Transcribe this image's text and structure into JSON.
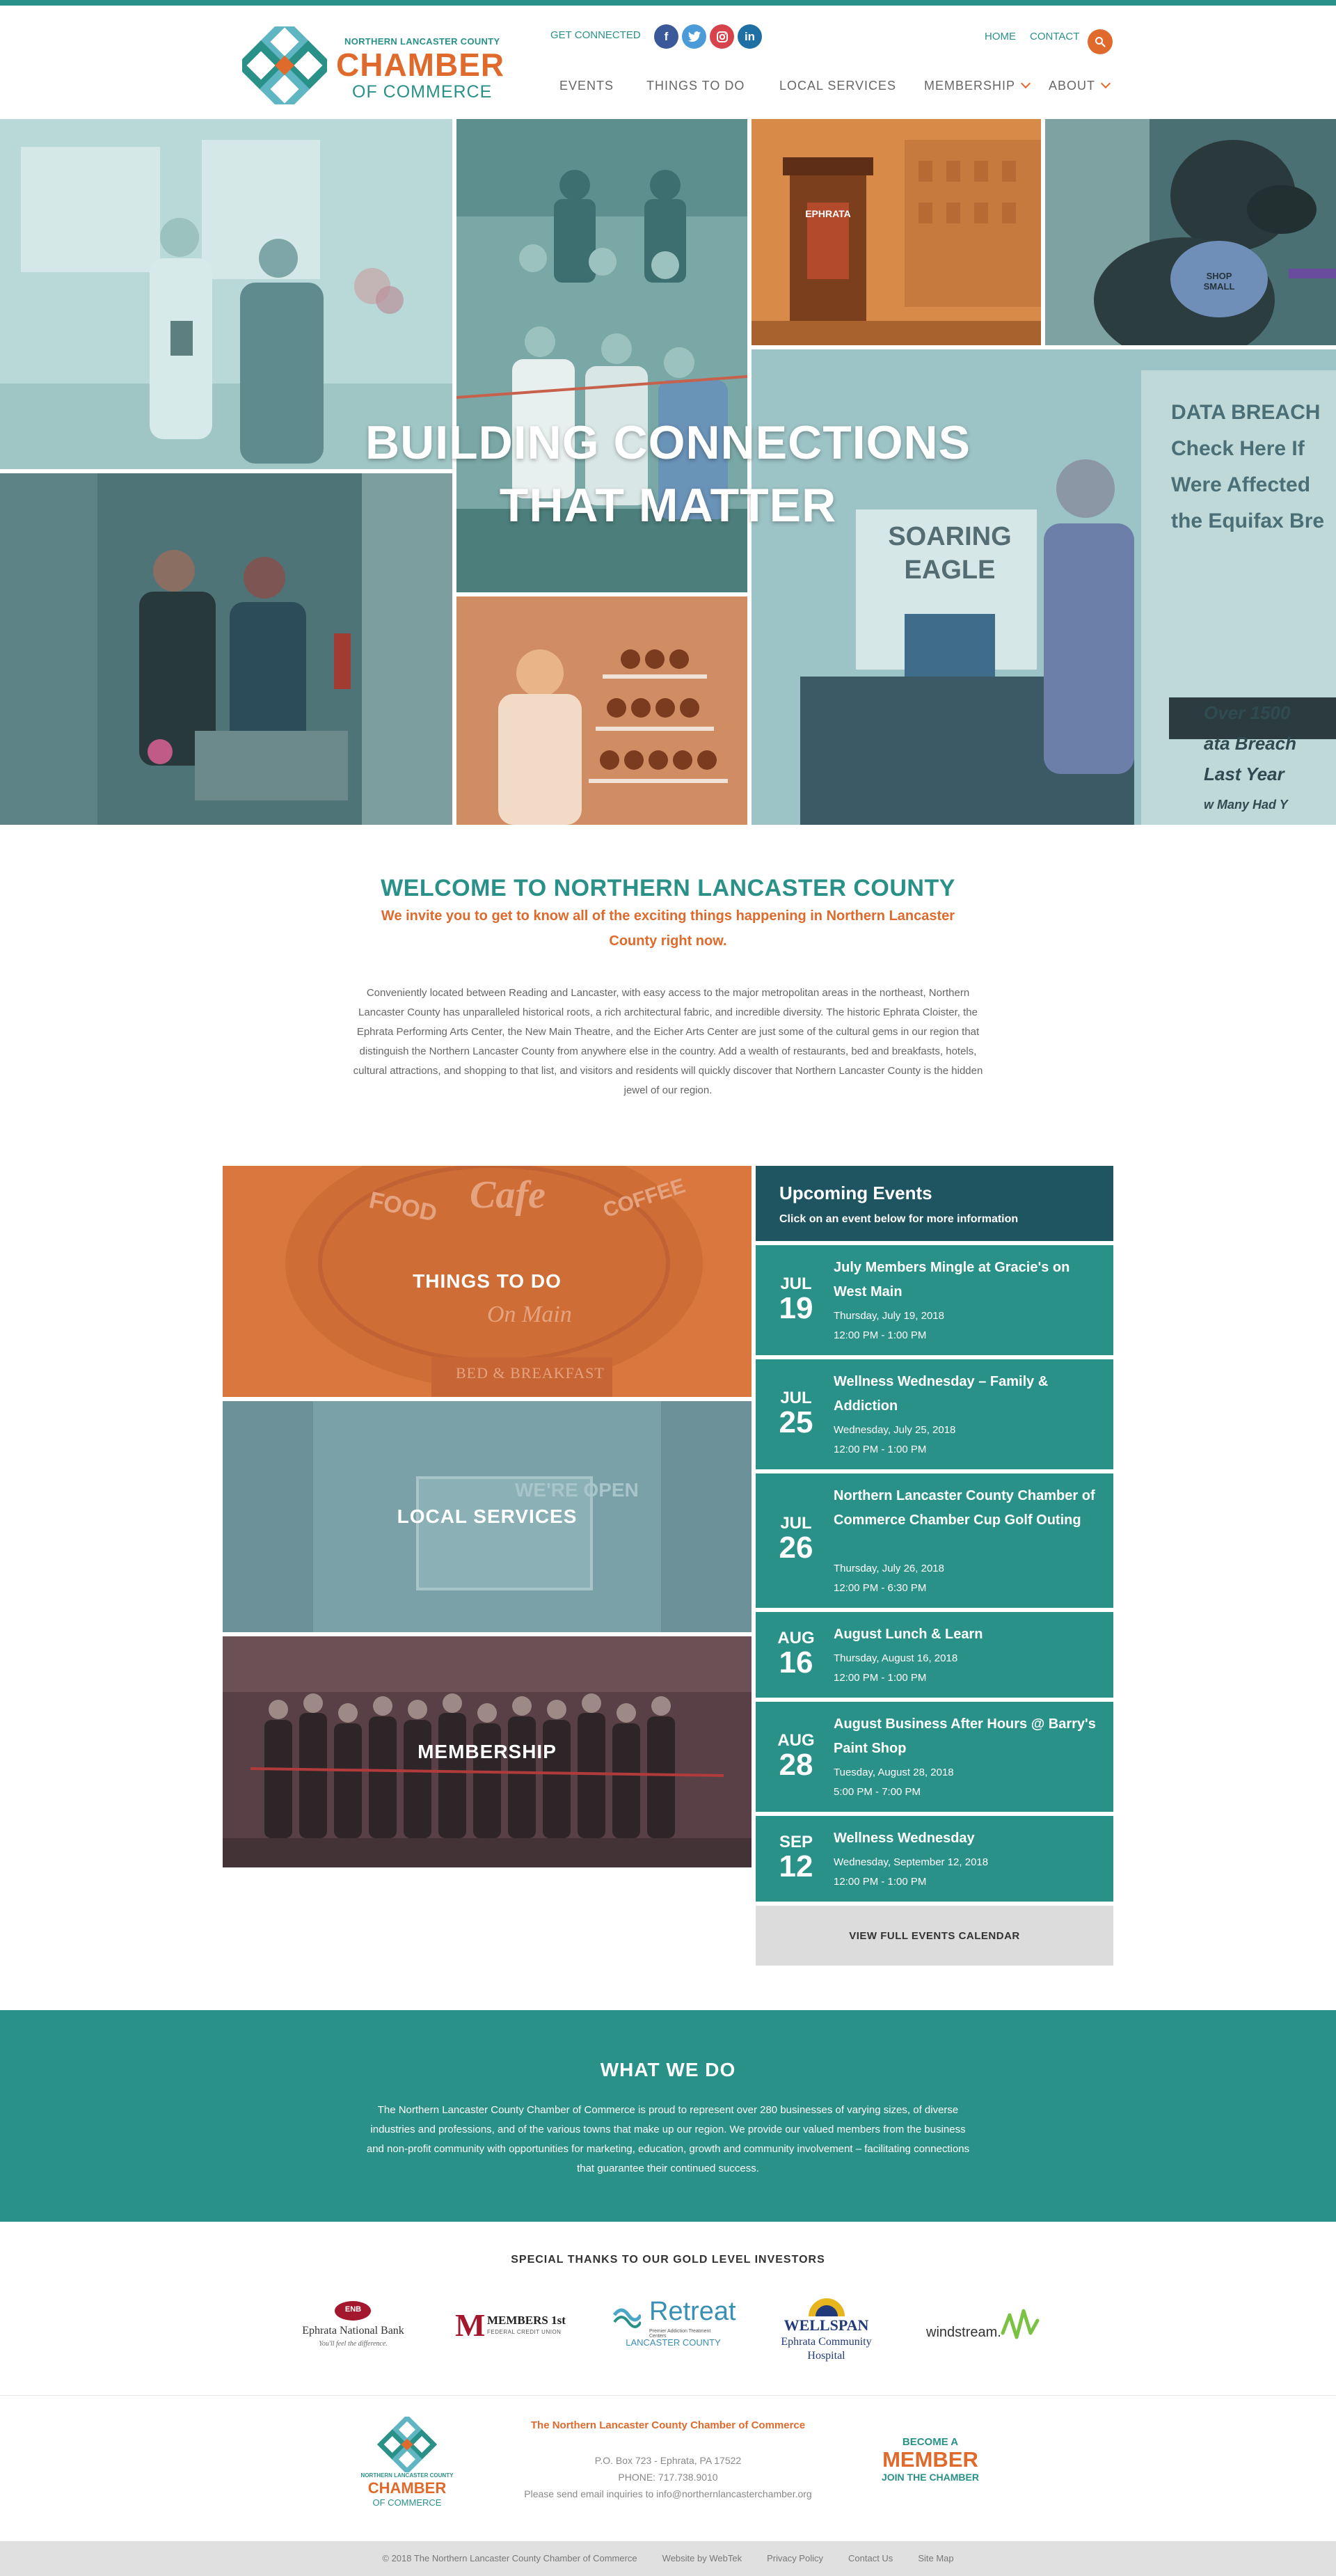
{
  "brand": {
    "logo_small": "NORTHERN LANCASTER COUNTY",
    "logo_big": "CHAMBER",
    "logo_sub": "OF COMMERCE",
    "teal": "#2a9189",
    "orange": "#e06a2c",
    "dark_teal": "#1f5560"
  },
  "header": {
    "get_connected": "GET CONNECTED",
    "socials": [
      {
        "name": "facebook-icon",
        "glyph": "f"
      },
      {
        "name": "twitter-icon",
        "glyph": "t"
      },
      {
        "name": "instagram-icon",
        "glyph": "◎"
      },
      {
        "name": "linkedin-icon",
        "glyph": "in"
      }
    ],
    "util_nav": [
      "HOME",
      "CONTACT"
    ],
    "nav": {
      "events": "EVENTS",
      "things": "THINGS TO DO",
      "local": "LOCAL SERVICES",
      "membership": "MEMBERSHIP",
      "about": "ABOUT"
    }
  },
  "hero": {
    "line1": "BUILDING CONNECTIONS",
    "line2": "THAT MATTER",
    "sign_title": "EPHRATA",
    "poster_text": "DATA BREACH",
    "poster_lines": [
      "Check Here If",
      "Were Affected",
      "the Equifax Bre"
    ],
    "poster_bottom": [
      "Over 1500",
      "ata Breach",
      "Last Year",
      "w Many Had Y"
    ],
    "board_text": [
      "SOARING",
      "EAGLE"
    ],
    "dog_bandana": "SHOP SMALL"
  },
  "welcome": {
    "title": "WELCOME TO NORTHERN LANCASTER COUNTY",
    "subtitle": "We invite you to get to know all of the exciting things happening in Northern Lancaster County right now.",
    "body": "Conveniently located between Reading and Lancaster, with easy access to the major metropolitan areas in the northeast, Northern Lancaster County has unparalleled historical roots, a rich architectural fabric, and incredible diversity. The historic Ephrata Cloister, the Ephrata Performing Arts Center, the New Main Theatre, and the Eicher Arts Center are just some of the cultural gems in our region that distinguish the Northern Lancaster County from anywhere else in the country. Add a wealth of restaurants, bed and breakfasts, hotels, cultural attractions, and shopping to that list, and visitors and residents will quickly discover that Northern Lancaster County is the hidden jewel of our region."
  },
  "features": {
    "things": "THINGS TO DO",
    "local": "LOCAL SERVICES",
    "membership": "MEMBERSHIP",
    "cafe_sign": {
      "food": "FOOD",
      "cafe": "Cafe",
      "coffee": "COFFEE",
      "on_main": "On Main",
      "bnb": "BED & BREAKFAST"
    },
    "open_sign": "WE'RE OPEN"
  },
  "events": {
    "heading": "Upcoming Events",
    "subheading": "Click on an event below for more information",
    "items": [
      {
        "mon": "JUL",
        "day": "19",
        "title": "July Members Mingle at Gracie's on West Main",
        "date": "Thursday, July 19, 2018",
        "time": "12:00 PM - 1:00 PM"
      },
      {
        "mon": "JUL",
        "day": "25",
        "title": "Wellness Wednesday – Family & Addiction",
        "date": "Wednesday, July 25, 2018",
        "time": "12:00 PM - 1:00 PM"
      },
      {
        "mon": "JUL",
        "day": "26",
        "title": "Northern Lancaster County Chamber of Commerce Chamber Cup Golf Outing",
        "date": "Thursday, July 26, 2018",
        "time": "12:00 PM - 6:30 PM"
      },
      {
        "mon": "AUG",
        "day": "16",
        "title": "August Lunch & Learn",
        "date": "Thursday, August 16, 2018",
        "time": "12:00 PM - 1:00 PM"
      },
      {
        "mon": "AUG",
        "day": "28",
        "title": "August Business After Hours @ Barry's Paint Shop",
        "date": "Tuesday, August 28, 2018",
        "time": "5:00 PM - 7:00 PM"
      },
      {
        "mon": "SEP",
        "day": "12",
        "title": "Wellness Wednesday",
        "date": "Wednesday, September 12, 2018",
        "time": "12:00 PM - 1:00 PM"
      }
    ],
    "view_all": "VIEW FULL EVENTS CALENDAR"
  },
  "what_we_do": {
    "title": "WHAT WE DO",
    "body": "The Northern Lancaster County Chamber of Commerce is proud to represent over 280 businesses of varying sizes, of diverse industries and professions, and of the various towns that make up our region. We provide our valued members from the business and non-profit community with opportunities for marketing, education, growth and community involvement – facilitating connections that guarantee their continued success."
  },
  "sponsors": {
    "title": "SPECIAL THANKS TO OUR GOLD LEVEL INVESTORS",
    "ephrata": {
      "mark": "ENB",
      "name": "Ephrata National Bank",
      "tag": "You'll feel the difference."
    },
    "members1st": {
      "mark": "M",
      "name": "MEMBERS 1st",
      "sub": "FEDERAL CREDIT UNION"
    },
    "retreat": {
      "name": "Retreat",
      "tag": "Premier Addiction Treatment Centers",
      "sub": "LANCASTER COUNTY"
    },
    "wellspan": {
      "name": "WELLSPAN",
      "sub1": "Ephrata Community",
      "sub2": "Hospital"
    },
    "windstream": {
      "name": "windstream."
    }
  },
  "footer": {
    "logo_small": "NORTHERN LANCASTER COUNTY",
    "logo_big": "CHAMBER",
    "logo_sub": "OF COMMERCE",
    "org": "The Northern Lancaster County Chamber of Commerce",
    "address": "P.O. Box 723 - Ephrata, PA 17522",
    "phone": "PHONE: 717.738.9010",
    "email": "Please send email inquiries to info@northernlancasterchamber.org",
    "become1": "BECOME A",
    "become2": "MEMBER",
    "become3": "JOIN THE CHAMBER",
    "bottom": [
      "© 2018 The Northern Lancaster County Chamber of Commerce",
      "Website by WebTek",
      "Privacy Policy",
      "Contact Us",
      "Site Map"
    ]
  }
}
